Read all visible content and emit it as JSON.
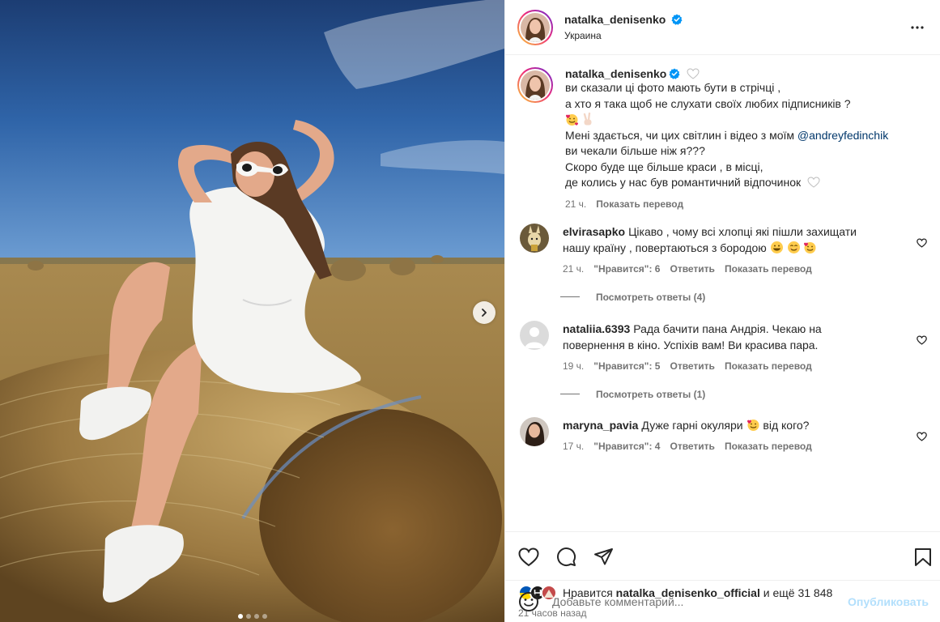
{
  "post": {
    "author": {
      "username": "natalka_denisenko",
      "location": "Украина",
      "verified": true
    },
    "media": {
      "slide_count": 4,
      "active_slide": 1,
      "next_icon": "chevron-right-icon"
    },
    "caption": {
      "username": "natalka_denisenko",
      "line_1": "ви сказали ці фото мають бути в стрічці ,",
      "line_2": "а хто я така щоб не слухати своїх любих підписників ?",
      "line_3_prefix": "Мені здається, чи цих світлин і відео з моїм ",
      "mention": "@andreyfedinchik",
      "line_4": "ви чекали більше ніж я???",
      "line_5": "Скоро буде ще більше краси , в місці,",
      "line_6": "де колись у нас був романтичний відпочинок",
      "time": "21 ч.",
      "translate": "Показать перевод"
    },
    "comments": [
      {
        "username": "elvirasapko",
        "text_line_1": "Цікаво , чому всі хлопці які пішли захищати",
        "text_line_2": "нашу країну , повертаються з бородою",
        "time": "21 ч.",
        "likes": "\"Нравится\": 6",
        "reply": "Ответить",
        "translate": "Показать перевод",
        "view_replies": "Посмотреть ответы (4)"
      },
      {
        "username": "nataliia.6393",
        "text_line_1": "Рада бачити пана Андрія. Чекаю на",
        "text_line_2": "повернення в кіно. Успіхів вам! Ви красива пара.",
        "time": "19 ч.",
        "likes": "\"Нравится\": 5",
        "reply": "Ответить",
        "translate": "Показать перевод",
        "view_replies": "Посмотреть ответы (1)"
      },
      {
        "username": "maryna_pavia",
        "text_before": "Дуже гарні окуляри",
        "text_after": "від кого?",
        "time": "17 ч.",
        "likes": "\"Нравится\": 4",
        "reply": "Ответить",
        "translate": "Показать перевод"
      }
    ],
    "likes": {
      "prefix": "Нравится",
      "user": "natalka_denisenko_official",
      "suffix": "и ещё 31 848"
    },
    "posted_ago": "21 часов назад",
    "add_comment": {
      "placeholder": "Добавьте комментарий...",
      "post_button": "Опубликовать"
    }
  },
  "colors": {
    "link": "#00376b",
    "secondary_text": "#737373",
    "post_button_disabled": "#b2dffc",
    "verified_badge": "#0095f6",
    "ring_gradient": [
      "#f9ce34",
      "#ee2a7b",
      "#6228d7"
    ]
  },
  "icons": [
    "more-icon",
    "verified-icon",
    "heart-icon",
    "comment-icon",
    "share-icon",
    "bookmark-icon",
    "smile-icon",
    "chevron-right-icon"
  ]
}
